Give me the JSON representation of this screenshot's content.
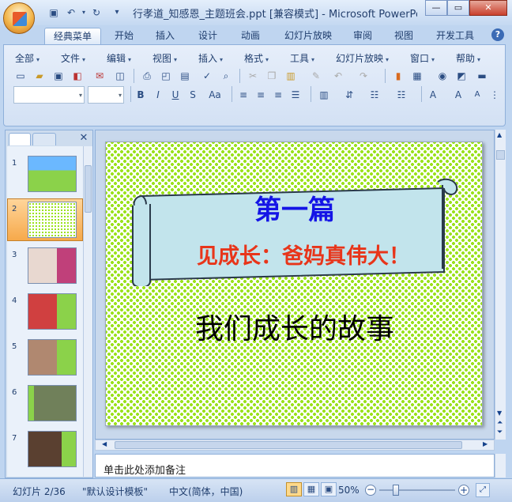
{
  "window": {
    "title": "行孝道_知感恩_主题班会.ppt [兼容模式] - Microsoft PowerPoi...",
    "minimize": "—",
    "restore": "▭",
    "close": "✕"
  },
  "qat": {
    "save_icon": "save-icon",
    "undo_icon": "undo-icon",
    "redo_icon": "redo-icon",
    "customize_icon": "customize-icon"
  },
  "tabs": [
    "经典菜单",
    "开始",
    "插入",
    "设计",
    "动画",
    "幻灯片放映",
    "审阅",
    "视图",
    "开发工具"
  ],
  "menus": [
    "全部",
    "文件",
    "编辑",
    "视图",
    "插入",
    "格式",
    "工具",
    "幻灯片放映",
    "窗口",
    "帮助"
  ],
  "slides_panel": {
    "numbers": [
      "1",
      "2",
      "3",
      "4",
      "5",
      "6",
      "7"
    ],
    "selected": 2,
    "close": "✕"
  },
  "slide": {
    "heading": "第一篇",
    "subheading": "见成长：爸妈真伟大！",
    "body": "我们成长的故事",
    "colors": {
      "heading": "#1414e6",
      "subheading": "#e8351a",
      "pattern": "#9be21d",
      "scroll": "#c2e4ec"
    }
  },
  "notes": {
    "placeholder": "单击此处添加备注"
  },
  "status": {
    "slide_info": "幻灯片 2/36",
    "template": "\"默认设计模板\"",
    "language": "中文(简体，中国)",
    "zoom": "50%",
    "zoom_level": 0.5
  }
}
